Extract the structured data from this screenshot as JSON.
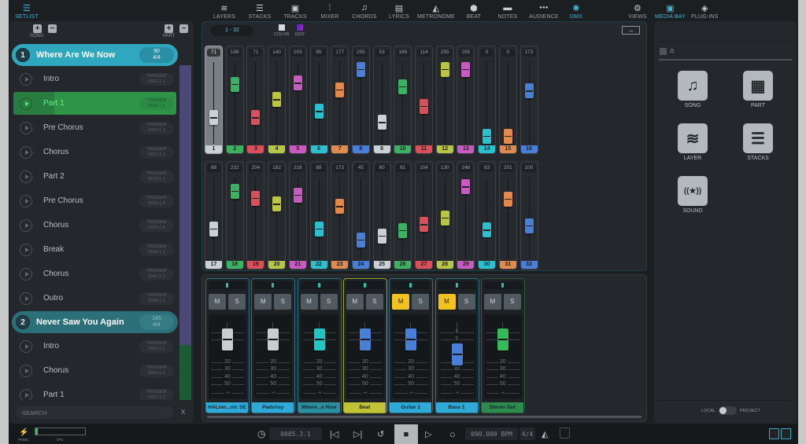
{
  "left_panel": {
    "tab": {
      "label": "SETLIST",
      "icon": "list-icon"
    },
    "song_controls_label": "SONG",
    "part_controls_label": "PART",
    "songs": [
      {
        "number": "1",
        "title": "Where Are We Now",
        "bpm": "90",
        "signature": "4/4",
        "color": "#2fa7bf",
        "selected": true,
        "parts": [
          {
            "name": "Intro",
            "trigger_label": "TRIGGER",
            "trigger": "0001.1.1"
          },
          {
            "name": "Part 1",
            "trigger_label": "TRIGGER",
            "trigger": "0004.1.1",
            "active": true
          },
          {
            "name": "Pre Chorus",
            "trigger_label": "TRIGGER",
            "trigger": "0010.1.1"
          },
          {
            "name": "Chorus",
            "trigger_label": "TRIGGER",
            "trigger": "0013.1.1"
          },
          {
            "name": "Part 2",
            "trigger_label": "TRIGGER",
            "trigger": "0019.1.1"
          },
          {
            "name": "Pre Chorus",
            "trigger_label": "TRIGGER",
            "trigger": "0025.1.4"
          },
          {
            "name": "Chorus",
            "trigger_label": "TRIGGER",
            "trigger": "0028.1.4"
          },
          {
            "name": "Break",
            "trigger_label": "TRIGGER",
            "trigger": "0034.1.1"
          },
          {
            "name": "Chorus",
            "trigger_label": "TRIGGER",
            "trigger": "0042.1.1"
          },
          {
            "name": "Outro",
            "trigger_label": "TRIGGER",
            "trigger": "0048.1.1"
          }
        ]
      },
      {
        "number": "2",
        "title": "Never Saw You Again",
        "bpm": "145",
        "signature": "4/4",
        "color": "#2b6f78",
        "selected": false,
        "parts": [
          {
            "name": "Intro",
            "trigger_label": "TRIGGER",
            "trigger": "0001.1.1"
          },
          {
            "name": "Chorus",
            "trigger_label": "TRIGGER",
            "trigger": "0004.1.1"
          },
          {
            "name": "Part 1",
            "trigger_label": "TRIGGER",
            "trigger": "0007.1.1"
          }
        ]
      }
    ],
    "search": {
      "placeholder": "SEARCH",
      "clear": "X"
    }
  },
  "toolbar": {
    "tabs": [
      {
        "label": "LAYERS",
        "icon": "layers-icon",
        "glyph": "≋"
      },
      {
        "label": "STACKS",
        "icon": "stacks-icon",
        "glyph": "☰"
      },
      {
        "label": "TRACKS",
        "icon": "tracks-icon",
        "glyph": "▣"
      },
      {
        "label": "MIXER",
        "icon": "mixer-icon",
        "glyph": "⫶"
      },
      {
        "label": "CHORDS",
        "icon": "chords-icon",
        "glyph": "♫"
      },
      {
        "label": "LYRICS",
        "icon": "lyrics-icon",
        "glyph": "▤"
      },
      {
        "label": "METRONOME",
        "icon": "metronome-icon",
        "glyph": "◭"
      },
      {
        "label": "BEAT",
        "icon": "beat-icon",
        "glyph": "⬢"
      },
      {
        "label": "NOTES",
        "icon": "notes-icon",
        "glyph": "▬"
      },
      {
        "label": "AUDIENCE",
        "icon": "audience-icon",
        "glyph": "●●●"
      },
      {
        "label": "DMX",
        "icon": "dmx-icon",
        "glyph": "✺",
        "active": true
      },
      {
        "label": "VIEWS",
        "icon": "gear-icon",
        "glyph": "⚙"
      }
    ]
  },
  "dmx": {
    "range": "1 - 32",
    "color_label": "COLOR",
    "edit_label": "EDIT",
    "next_icon": "→",
    "channels": [
      {
        "n": "1",
        "value": 71,
        "color": "#c9d1d7",
        "selected": true
      },
      {
        "n": "2",
        "value": 198,
        "color": "#3bb262"
      },
      {
        "n": "3",
        "value": 71,
        "color": "#d9505b"
      },
      {
        "n": "4",
        "value": 140,
        "color": "#b9c644"
      },
      {
        "n": "5",
        "value": 203,
        "color": "#c85bc0"
      },
      {
        "n": "6",
        "value": 95,
        "color": "#2bc0cf"
      },
      {
        "n": "7",
        "value": 177,
        "color": "#e08a4d"
      },
      {
        "n": "8",
        "value": 255,
        "color": "#4a7fd8"
      },
      {
        "n": "9",
        "value": 53,
        "color": "#c9d1d7"
      },
      {
        "n": "10",
        "value": 189,
        "color": "#3bb262"
      },
      {
        "n": "11",
        "value": 114,
        "color": "#d9505b"
      },
      {
        "n": "12",
        "value": 255,
        "color": "#b9c644"
      },
      {
        "n": "13",
        "value": 255,
        "color": "#c85bc0"
      },
      {
        "n": "14",
        "value": 0,
        "color": "#2bc0cf"
      },
      {
        "n": "15",
        "value": 0,
        "color": "#e08a4d"
      },
      {
        "n": "16",
        "value": 173,
        "color": "#4a7fd8"
      },
      {
        "n": "17",
        "value": 88,
        "color": "#c9d1d7"
      },
      {
        "n": "18",
        "value": 232,
        "color": "#3bb262"
      },
      {
        "n": "19",
        "value": 204,
        "color": "#d9505b"
      },
      {
        "n": "20",
        "value": 182,
        "color": "#b9c644"
      },
      {
        "n": "21",
        "value": 216,
        "color": "#c85bc0"
      },
      {
        "n": "22",
        "value": 88,
        "color": "#2bc0cf"
      },
      {
        "n": "23",
        "value": 173,
        "color": "#e08a4d"
      },
      {
        "n": "24",
        "value": 45,
        "color": "#4a7fd8"
      },
      {
        "n": "25",
        "value": 60,
        "color": "#c9d1d7"
      },
      {
        "n": "26",
        "value": 81,
        "color": "#3bb262"
      },
      {
        "n": "27",
        "value": 104,
        "color": "#d9505b"
      },
      {
        "n": "28",
        "value": 130,
        "color": "#b9c644"
      },
      {
        "n": "29",
        "value": 248,
        "color": "#c85bc0"
      },
      {
        "n": "30",
        "value": 83,
        "color": "#2bc0cf"
      },
      {
        "n": "31",
        "value": 201,
        "color": "#e08a4d"
      },
      {
        "n": "32",
        "value": 100,
        "color": "#4a7fd8"
      }
    ]
  },
  "mixer": {
    "mute_label": "M",
    "solo_label": "S",
    "scale_labels": [
      "5",
      "0",
      "20",
      "30",
      "40",
      "50",
      "-∞"
    ],
    "channels": [
      {
        "name": "HALion...nic SE",
        "label_color": "#2fa9d6",
        "fader_color": "#c9cdd0",
        "fader_db": "0",
        "mute": false,
        "solo": false
      },
      {
        "name": "Padshop",
        "label_color": "#2fa9d6",
        "fader_color": "#c9cdd0",
        "fader_db": "0",
        "mute": false,
        "solo": false
      },
      {
        "name": "Where...e Now",
        "label_color": "#2b8f9f",
        "fader_color": "#22c6c2",
        "fader_db": "0",
        "mute": false,
        "solo": false
      },
      {
        "name": "Beat",
        "label_color": "#c2c236",
        "fader_color": "#4a7fd8",
        "fader_db": "0",
        "mute": false,
        "solo": false,
        "border_color": "#9aa52b"
      },
      {
        "name": "Guitar 1",
        "label_color": "#2fa9d6",
        "fader_color": "#4a7fd8",
        "fader_db": "0",
        "mute": true,
        "solo": false
      },
      {
        "name": "Bass 1",
        "label_color": "#2fa9d6",
        "fader_color": "#4a7fd8",
        "fader_db": "-10",
        "mute": true,
        "solo": false
      },
      {
        "name": "Stereo Out",
        "label_color": "#2e8a4d",
        "fader_color": "#35b95b",
        "fader_db": "0",
        "mute": false,
        "solo": false,
        "border_color": "#2c5a3c"
      }
    ]
  },
  "right_panel": {
    "tabs": [
      {
        "label": "MEDIA BAY",
        "icon": "media-bay-icon",
        "active": true
      },
      {
        "label": "PLUG-INS",
        "icon": "plugins-icon"
      }
    ],
    "tiles": [
      {
        "label": "SONG",
        "icon": "music-note-icon",
        "glyph": "♫"
      },
      {
        "label": "PART",
        "icon": "part-icon",
        "glyph": "▦"
      },
      {
        "label": "LAYER",
        "icon": "layers-icon",
        "glyph": "≋"
      },
      {
        "label": "STACKS",
        "icon": "stacks-icon",
        "glyph": "☰"
      },
      {
        "label": "SOUND",
        "icon": "sound-icon",
        "glyph": "((★))"
      }
    ],
    "toggle": {
      "left": "LOCAL",
      "right": "PROJECT"
    }
  },
  "transport": {
    "panic_label": "PANIC",
    "cpu_label": "CPU",
    "cpu_load": 0.04,
    "position": "0005.3.1",
    "tempo": "090.000 BPM",
    "signature": "4/4",
    "buttons": {
      "prev": "⏮",
      "next": "⏭",
      "loop": "↺",
      "stop": "■",
      "play": "▷",
      "record": "○"
    }
  }
}
